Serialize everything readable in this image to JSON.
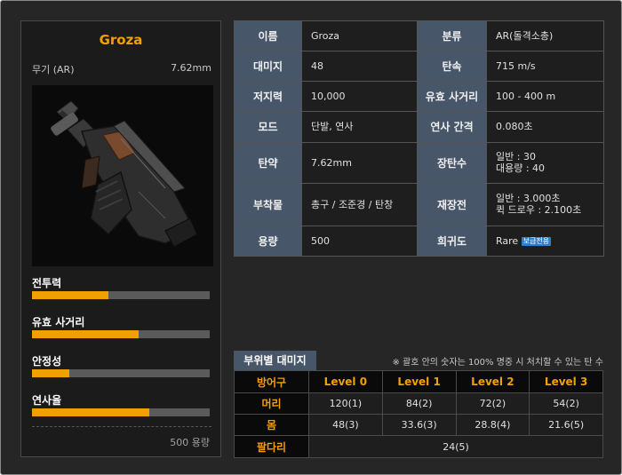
{
  "weapon": {
    "name": "Groza",
    "class_label": "무기 (AR)",
    "caliber": "7.62mm",
    "image": "groza-rifle-icon",
    "capacity": "500 용량"
  },
  "stats": [
    {
      "label": "전투력",
      "value": 0.43
    },
    {
      "label": "유효 사거리",
      "value": 0.6
    },
    {
      "label": "안정성",
      "value": 0.21
    },
    {
      "label": "연사율",
      "value": 0.66
    }
  ],
  "info": {
    "name_label": "이름",
    "name_value": "Groza",
    "category_label": "분류",
    "category_value": "AR(돌격소총)",
    "damage_label": "대미지",
    "damage_value": "48",
    "speed_label": "탄속",
    "speed_value": "715 m/s",
    "stopping_label": "저지력",
    "stopping_value": "10,000",
    "range_label": "유효 사거리",
    "range_value": "100 - 400 m",
    "mode_label": "모드",
    "mode_value": "단발, 연사",
    "interval_label": "연사 간격",
    "interval_value": "0.080초",
    "ammo_label": "탄약",
    "ammo_value": "7.62mm",
    "mag_label": "장탄수",
    "mag_value_1": "일반 : 30",
    "mag_value_2": "대용량 : 40",
    "attach_label": "부착물",
    "attach_value": "총구 / 조준경 / 탄창",
    "reload_label": "재장전",
    "reload_value_1": "일반 : 3.000초",
    "reload_value_2": "퀵 드로우 : 2.100초",
    "capacity_label": "용량",
    "capacity_value": "500",
    "rarity_label": "희귀도",
    "rarity_value": "Rare",
    "rarity_badge": "보급전용"
  },
  "damage": {
    "tab_label": "부위별 대미지",
    "note": "※ 괄호 안의 숫자는 100% 명중 시 처치할 수 있는 탄 수",
    "header": [
      "방어구",
      "Level 0",
      "Level 1",
      "Level 2",
      "Level 3"
    ],
    "rows": [
      {
        "part": "머리",
        "values": [
          "120(1)",
          "84(2)",
          "72(2)",
          "54(2)"
        ]
      },
      {
        "part": "몸",
        "values": [
          "48(3)",
          "33.6(3)",
          "28.8(4)",
          "21.6(5)"
        ]
      }
    ],
    "limb_row": {
      "part": "팔다리",
      "value": "24(5)"
    }
  }
}
